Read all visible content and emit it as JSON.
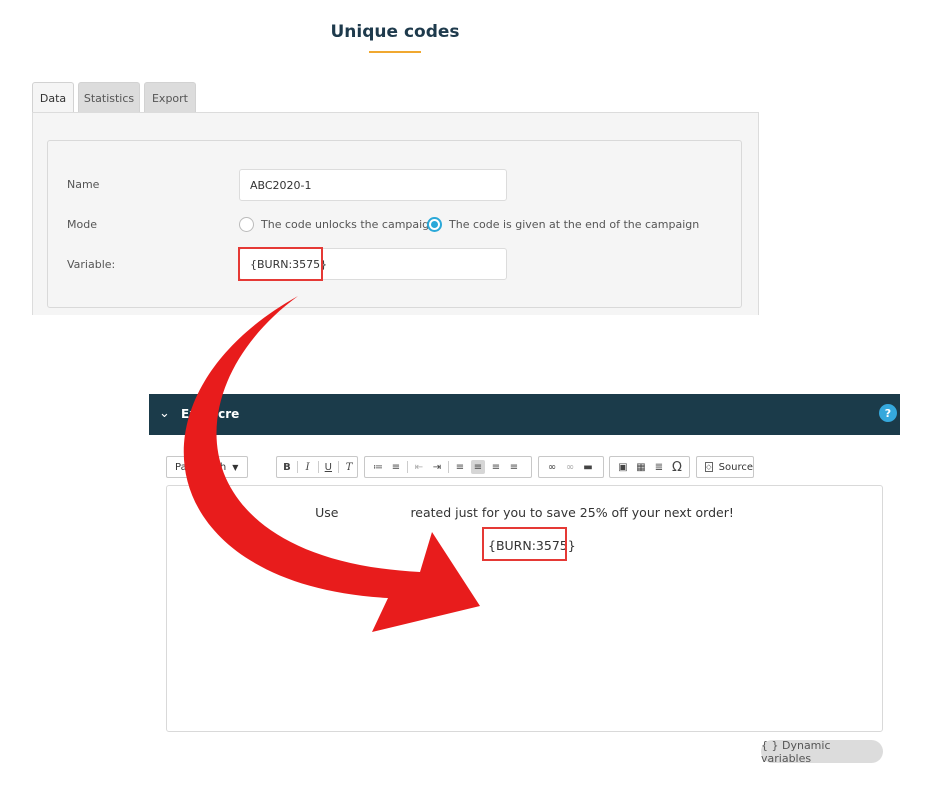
{
  "page": {
    "title": "Unique codes"
  },
  "tabs": [
    {
      "label": "Data",
      "active": true
    },
    {
      "label": "Statistics",
      "active": false
    },
    {
      "label": "Export",
      "active": false
    }
  ],
  "form": {
    "name_label": "Name",
    "name_value": "ABC2020-1",
    "mode_label": "Mode",
    "mode_options": [
      {
        "label": "The code unlocks the campaign",
        "selected": false
      },
      {
        "label": "The code is given at the end of the campaign",
        "selected": true
      }
    ],
    "variable_label": "Variable:",
    "variable_value": "{BURN:3575}"
  },
  "editor": {
    "bar_title": "Exit scre",
    "help_label": "?",
    "format_select": "Paragraph",
    "source_label": "Source",
    "content_line1_prefix": "Use",
    "content_line1_suffix": "reated just for you to save 25% off your next order!",
    "content_line2": "{BURN:3575}",
    "dynamic_variables_label": "{ } Dynamic variables"
  },
  "colors": {
    "accent_blue": "#2aa8d8",
    "highlight_red": "#e53935",
    "dark_bar": "#1b3b4a",
    "title_rule": "#f0a830"
  },
  "icons": {
    "collapse": "chevron-down-icon",
    "bold": "bold-icon",
    "italic": "italic-icon",
    "underline": "underline-icon",
    "clear_format": "clear-format-icon",
    "link": "link-icon",
    "image": "image-icon",
    "table": "table-icon",
    "special_char": "omega-icon",
    "source": "source-icon"
  }
}
